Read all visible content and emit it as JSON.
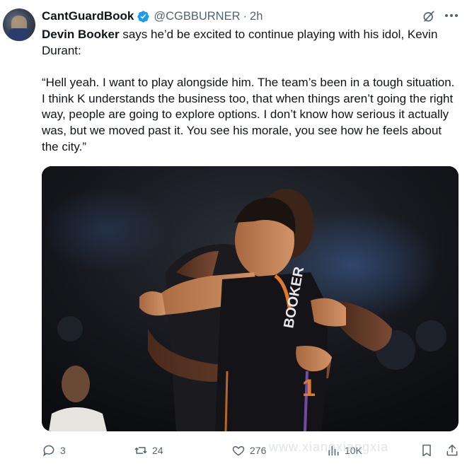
{
  "tweet": {
    "display_name": "CantGuardBook",
    "handle": "@CGBBURNER",
    "separator": "·",
    "time": "2h",
    "text_bold_name": "Devin Booker",
    "text_line1_rest": " says he’d be excited to continue playing with his idol, Kevin Durant:",
    "quote": "“Hell yeah. I want to play alongside him. The team’s been in a tough situation. I think K understands the business too, that when things aren’t going the right way, people are going to explore options. I don’t know how serious it actually was, but we moved past it. You see his morale, you see how he feels about the city.”",
    "jersey_text": "BOOKER",
    "jersey_number": "1"
  },
  "actions": {
    "replies": "3",
    "reposts": "24",
    "likes": "276",
    "views": "10K"
  },
  "watermark": "www.xiangxiangxia",
  "icons": {
    "verified": "verified-badge-icon",
    "grok": "grok-icon",
    "more": "more-icon",
    "reply": "reply-icon",
    "repost": "repost-icon",
    "like": "heart-icon",
    "views": "views-icon",
    "bookmark": "bookmark-icon",
    "share": "share-icon"
  },
  "colors": {
    "verified_blue": "#1d9bf0",
    "text_secondary": "#536471",
    "text_primary": "#0f1419"
  }
}
